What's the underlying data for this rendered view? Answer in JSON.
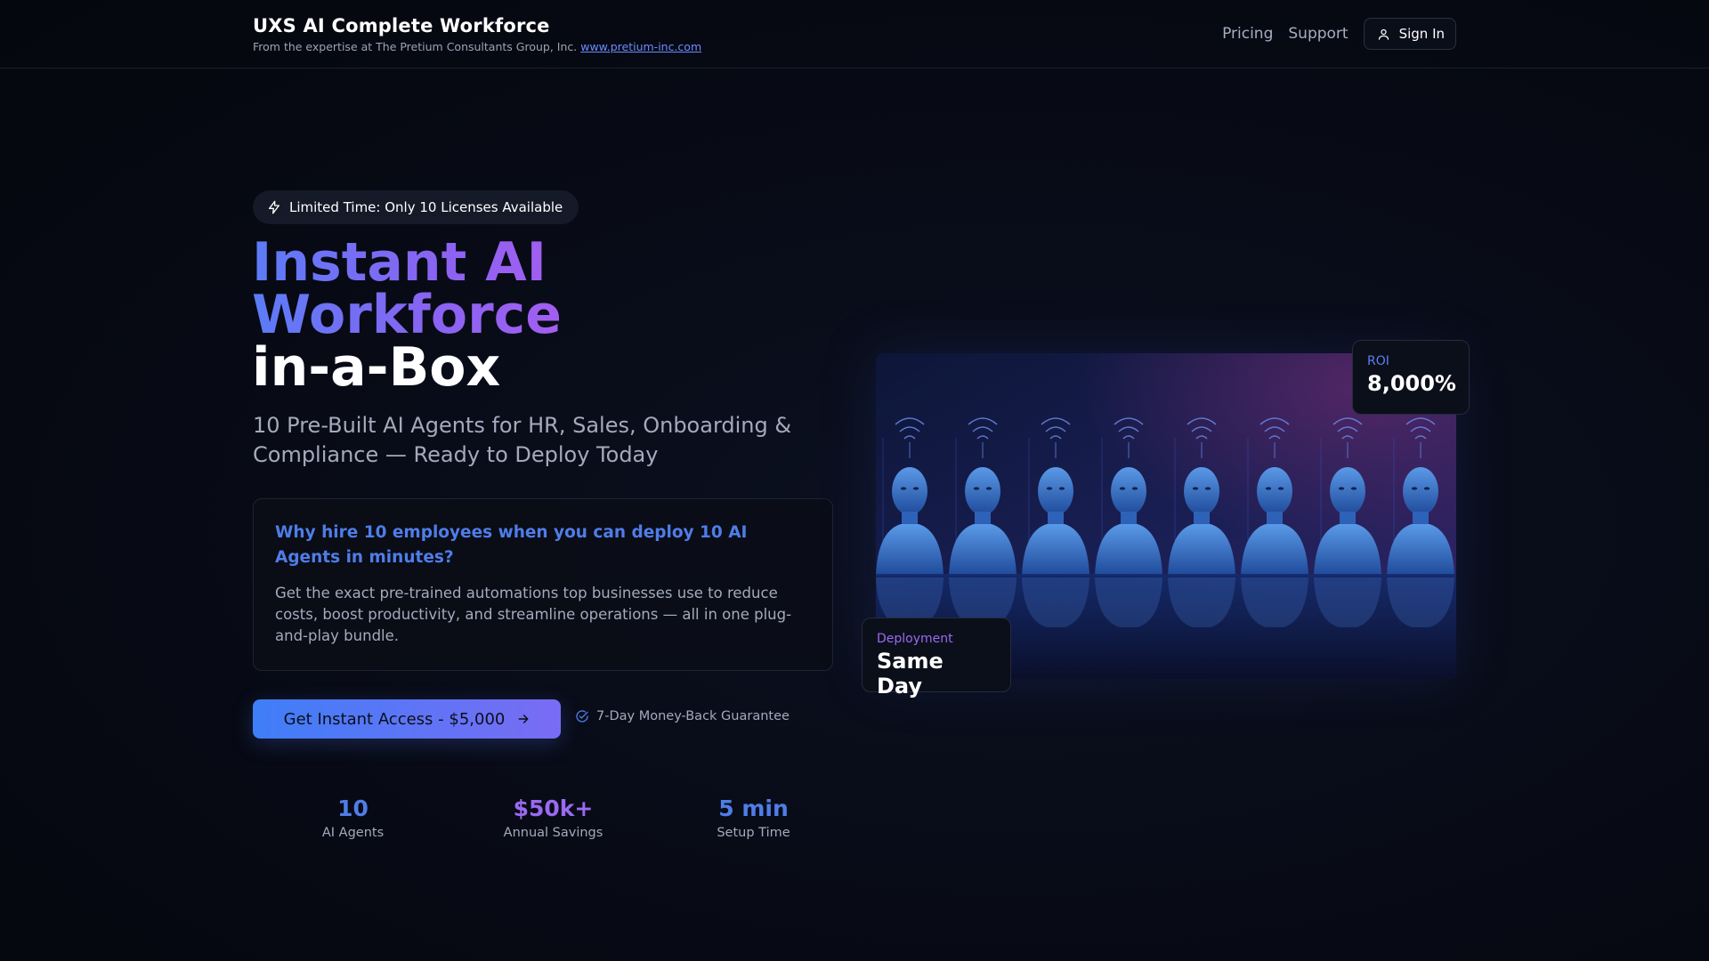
{
  "header": {
    "brand_title": "UXS AI Complete Workforce",
    "brand_sub_prefix": "From the expertise at The Pretium Consultants Group, Inc.",
    "brand_link": "www.pretium-inc.com",
    "nav": {
      "pricing": "Pricing",
      "support": "Support",
      "signin": "Sign In"
    }
  },
  "hero": {
    "badge": "Limited Time: Only 10 Licenses Available",
    "title_line1": "Instant AI",
    "title_line2": "Workforce",
    "title_line3": "in-a-Box",
    "subtitle": "10 Pre-Built AI Agents for HR, Sales, Onboarding & Compliance — Ready to Deploy Today",
    "card_question": "Why hire 10 employees when you can deploy 10 AI Agents in minutes?",
    "card_answer": "Get the exact pre-trained automations top businesses use to reduce costs, boost productivity, and streamline operations — all in one plug-and-play bundle.",
    "cta": "Get Instant Access - $5,000",
    "guarantee": "7-Day Money-Back Guarantee"
  },
  "stats": [
    {
      "value": "10",
      "label": "AI Agents",
      "color": "#4f7de8"
    },
    {
      "value": "$50k+",
      "label": "Annual Savings",
      "color": "#9a6af0"
    },
    {
      "value": "5 min",
      "label": "Setup Time",
      "color": "#4f7de8"
    }
  ],
  "floating": {
    "roi_label": "ROI",
    "roi_value": "8,000%",
    "deploy_label": "Deployment",
    "deploy_value": "Same Day"
  },
  "icons": {
    "badge": "lightning-icon",
    "signin": "user-icon",
    "cta": "arrow-right-icon",
    "guarantee": "check-circle-icon"
  },
  "colors": {
    "accent_blue": "#4f7de8",
    "accent_purple": "#9a6af0",
    "background": "#070a14"
  }
}
